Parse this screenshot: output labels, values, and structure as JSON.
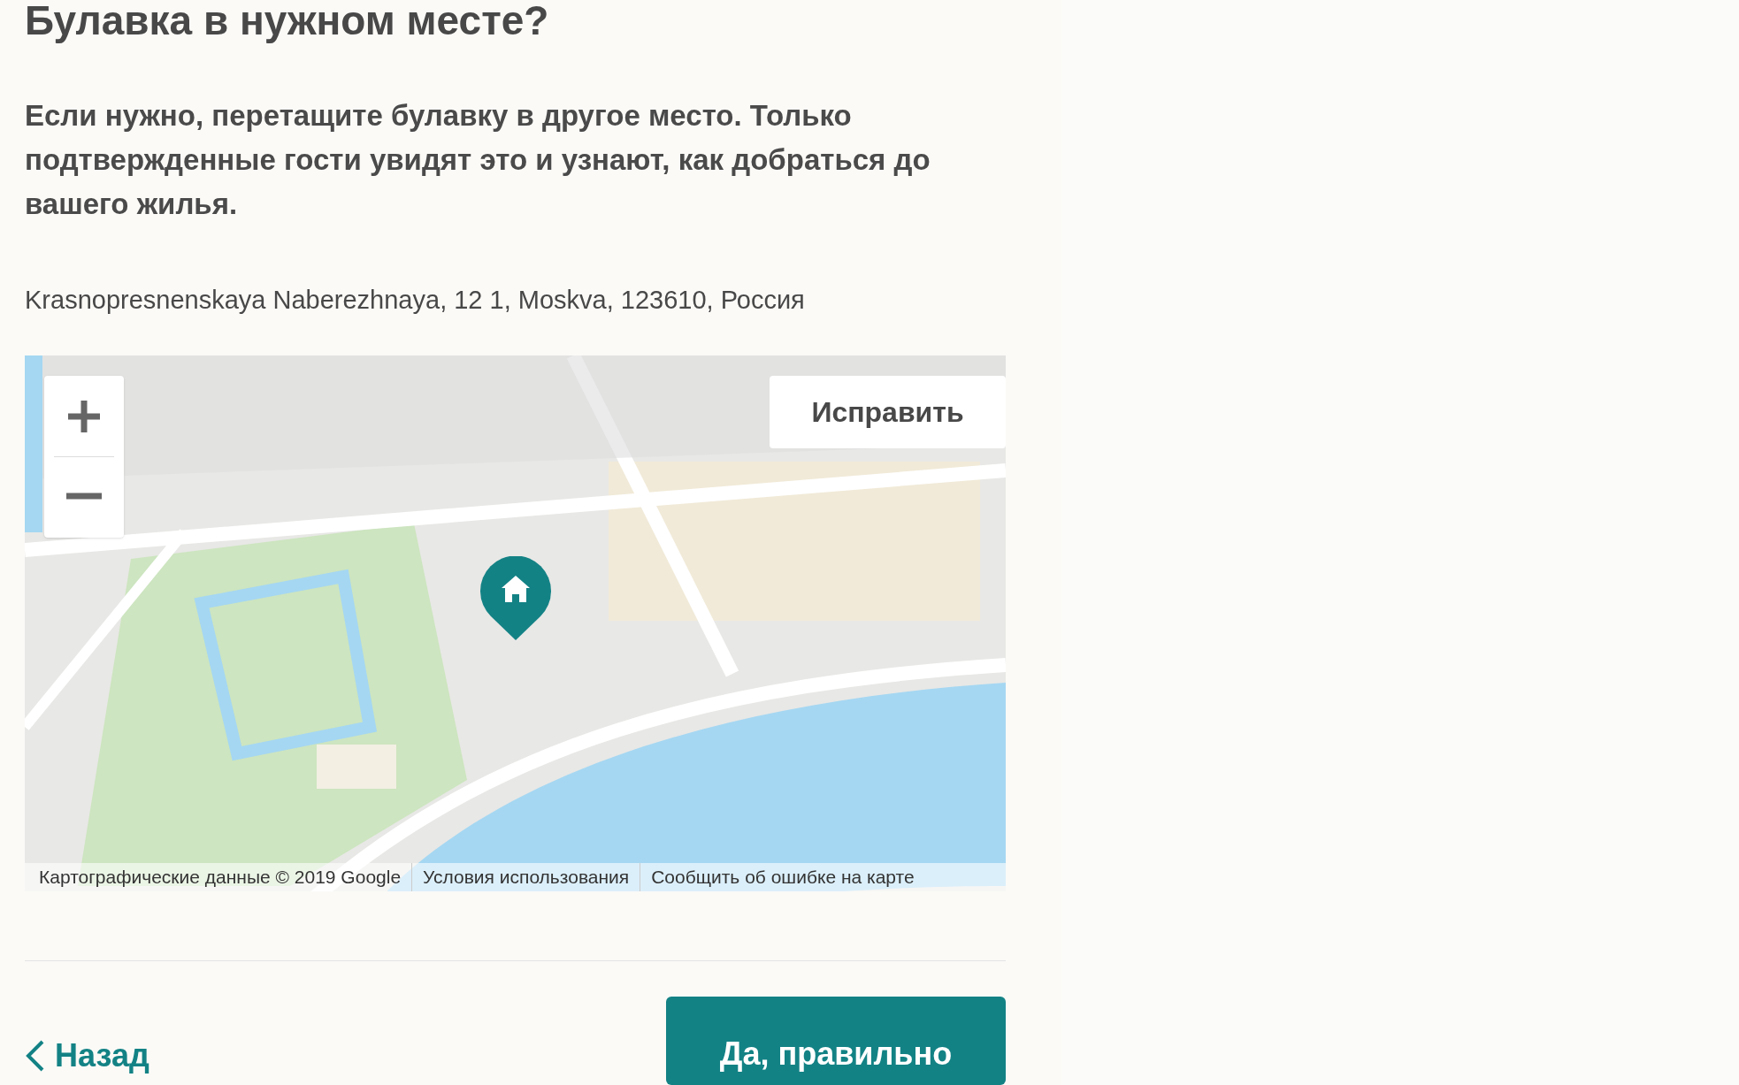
{
  "heading": "Булавка в нужном месте?",
  "description": "Если нужно, перетащите булавку в другое место. Только подтвержденные гости увидят это и узнают, как добраться до вашего жилья.",
  "address": "Krasnopresnenskaya Naberezhnaya, 12 1, Moskva, 123610, Россия",
  "map": {
    "edit_button": "Исправить",
    "attribution": [
      "Картографические данные © 2019 Google",
      "Условия использования",
      "Сообщить об ошибке на карте"
    ]
  },
  "footer": {
    "back": "Назад",
    "confirm": "Да, правильно"
  }
}
